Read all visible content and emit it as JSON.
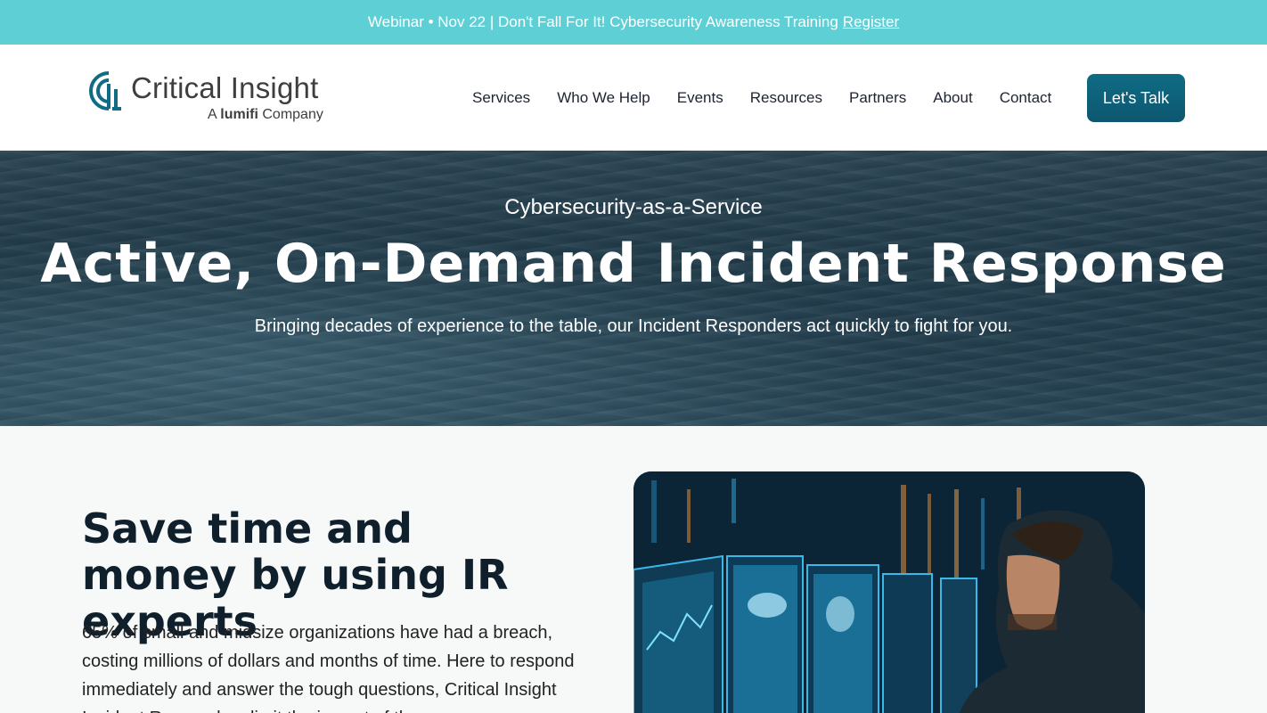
{
  "announcement": {
    "text": "Webinar • Nov 22 | Don't Fall For It! Cybersecurity Awareness Training",
    "link": "Register"
  },
  "header": {
    "logo_brand": "Critical Insight",
    "logo_sub_prefix": "A",
    "logo_sub_brand": "lumifi",
    "logo_sub_suffix": "Company",
    "nav": [
      "Services",
      "Who We Help",
      "Events",
      "Resources",
      "Partners",
      "About",
      "Contact"
    ],
    "cta": "Let's Talk"
  },
  "hero": {
    "eyebrow": "Cybersecurity-as-a-Service",
    "title": "Active, On-Demand Incident Response",
    "lede": "Bringing decades of experience to the table, our Incident Responders act quickly to fight for you."
  },
  "section": {
    "title": "Save time and money by using IR experts",
    "body": "65% of small and midsize organizations have had a breach, costing millions of dollars and months of time. Here to respond immediately and answer the tough questions, Critical Insight Incident Responders limit the impact of the"
  },
  "colors": {
    "announcement_bg": "#5fcfd6",
    "cta_bg": "#0f6c84",
    "heading": "#0f1f2c"
  }
}
